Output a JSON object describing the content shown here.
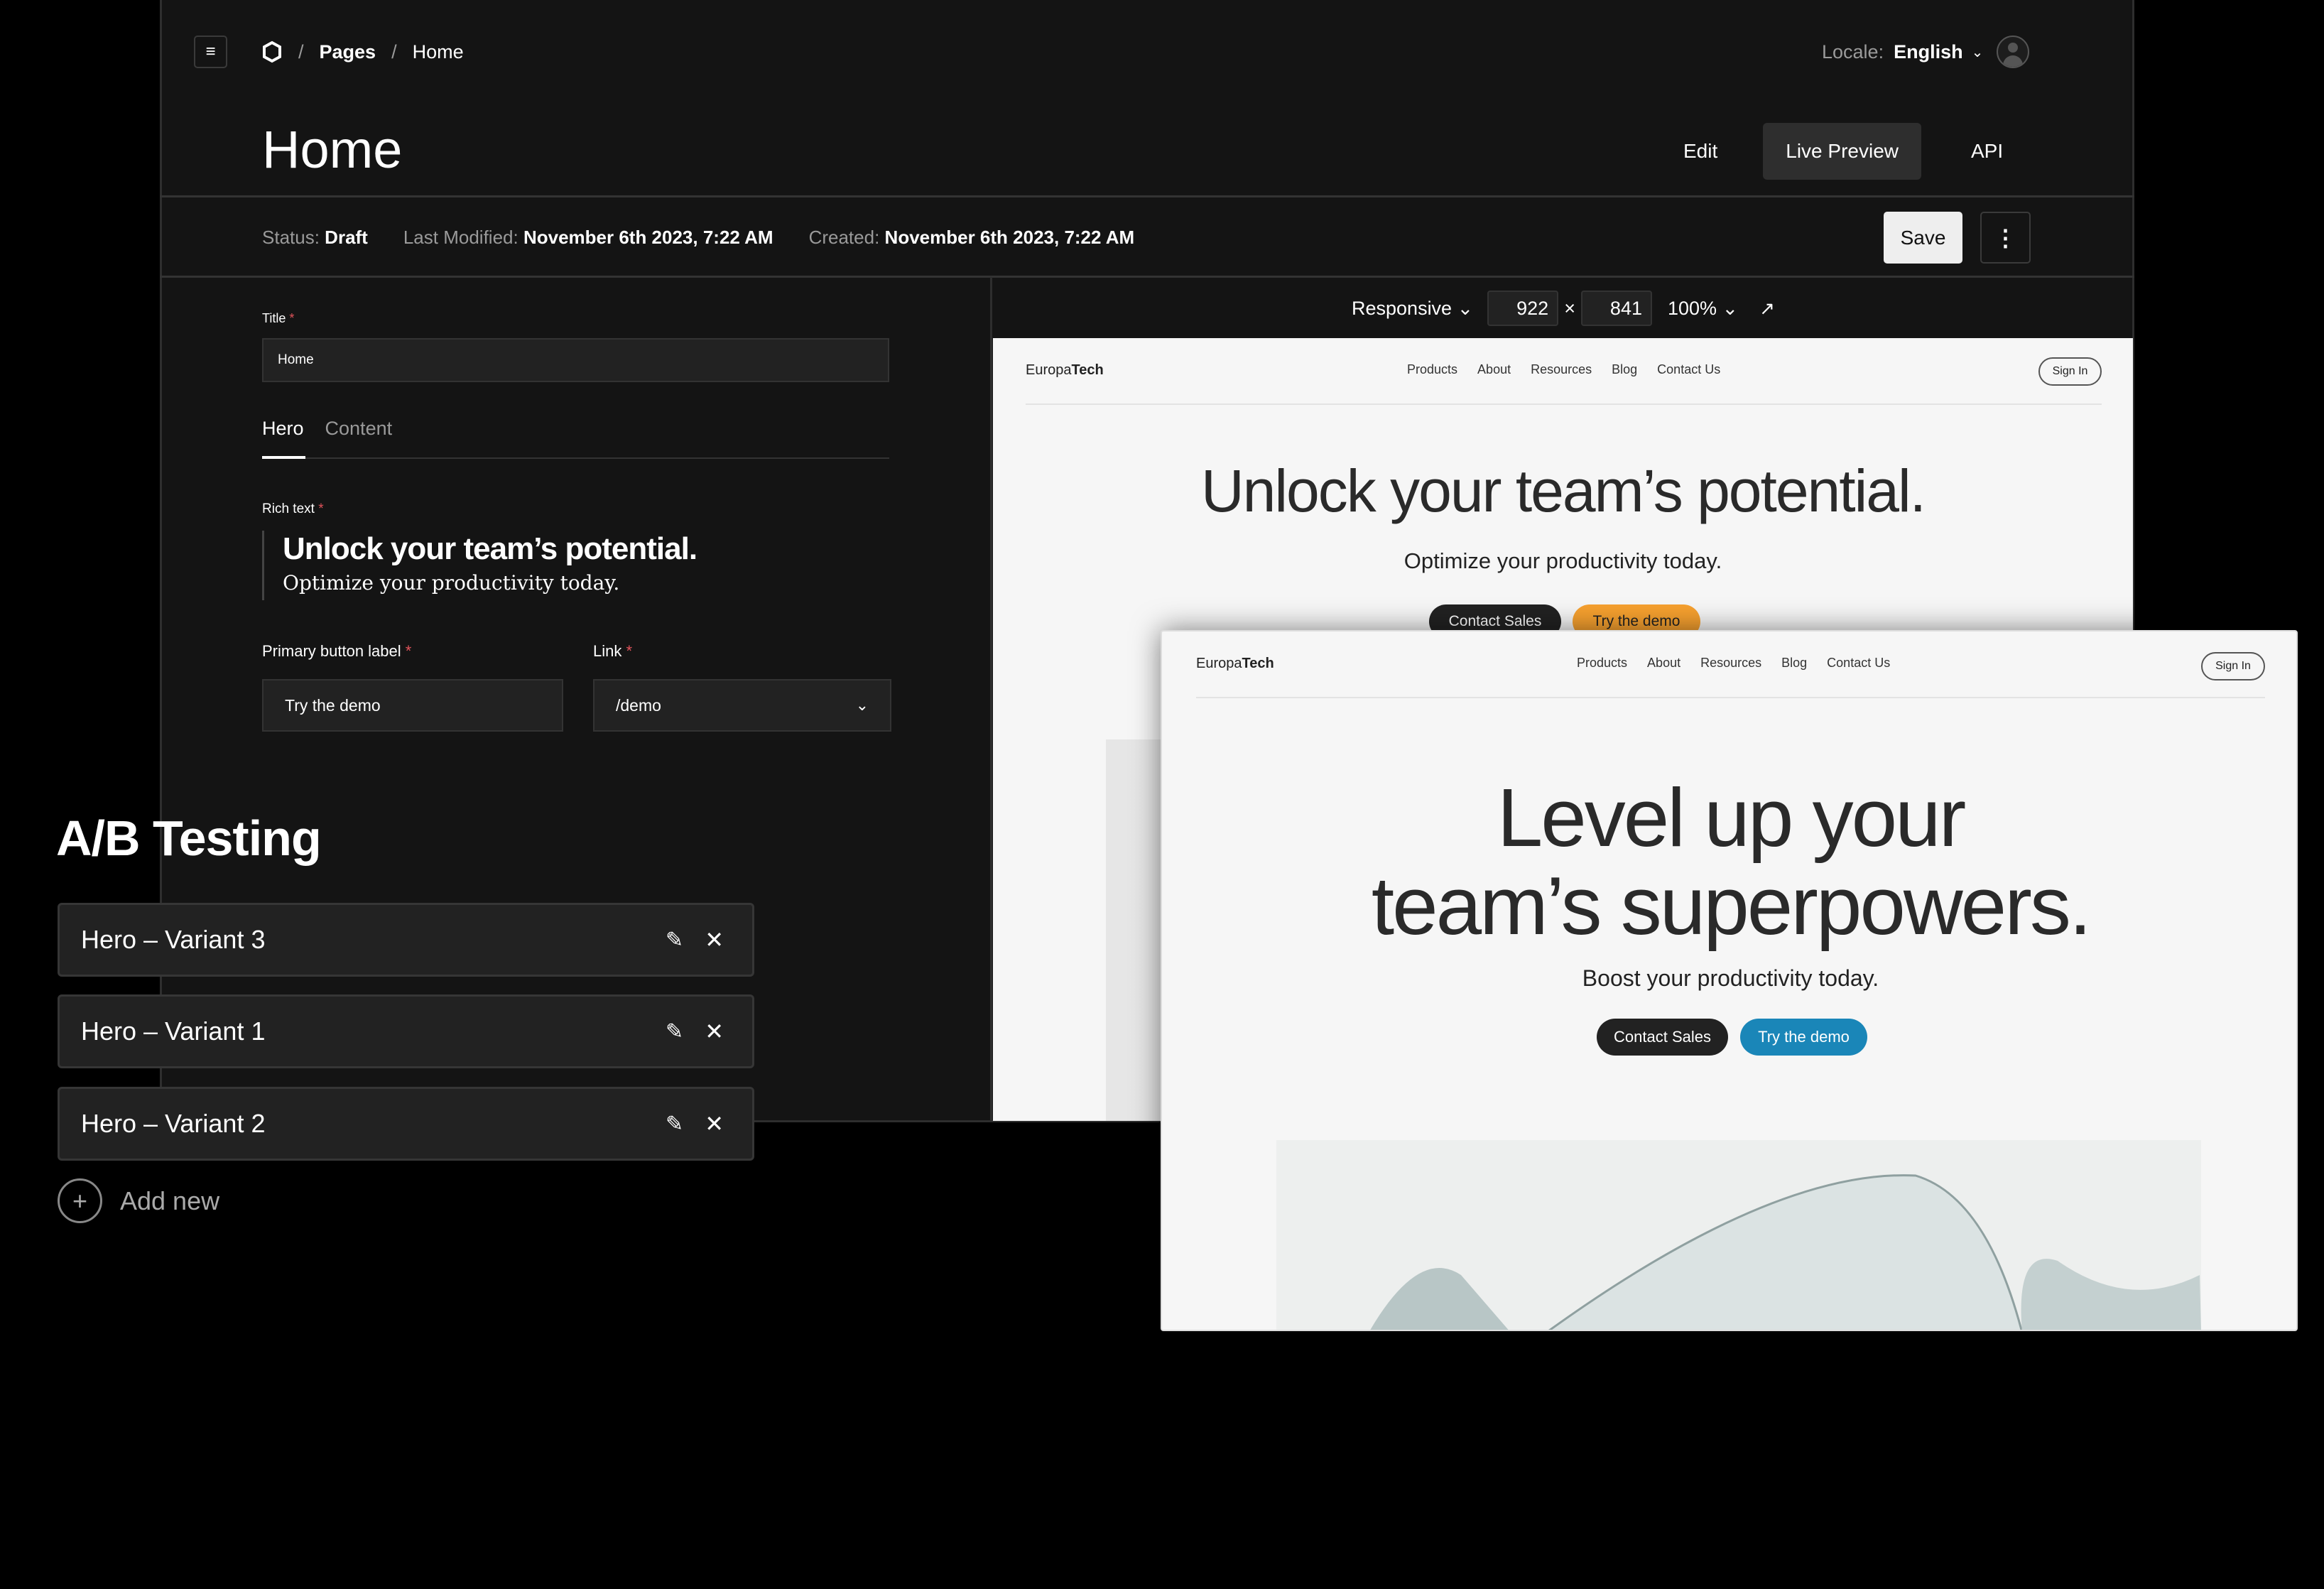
{
  "header": {
    "breadcrumb": [
      "Pages",
      "Home"
    ],
    "separator": "/",
    "locale_label": "Locale:",
    "locale_value": "English",
    "page_title": "Home",
    "tabs": [
      {
        "label": "Edit"
      },
      {
        "label": "Live Preview",
        "active": true
      },
      {
        "label": "API"
      }
    ]
  },
  "status_bar": {
    "status_label": "Status:",
    "status_value": "Draft",
    "modified_label": "Last Modified:",
    "modified_value": "November 6th 2023, 7:22 AM",
    "created_label": "Created:",
    "created_value": "November 6th 2023, 7:22 AM",
    "save_label": "Save"
  },
  "editor": {
    "title_label": "Title",
    "title_value": "Home",
    "tabs": [
      "Hero",
      "Content"
    ],
    "rich_text_label": "Rich text",
    "rich_heading": "Unlock your team’s potential.",
    "rich_sub": "Optimize your productivity today.",
    "button_label": "Primary button label",
    "button_value": "Try the demo",
    "link_label": "Link",
    "link_value": "/demo",
    "required_mark": "*"
  },
  "preview_toolbar": {
    "mode": "Responsive",
    "width": "922",
    "times": "×",
    "height": "841",
    "zoom": "100%"
  },
  "site": {
    "brand_a": "Europa",
    "brand_b": "Tech",
    "nav": [
      "Products",
      "About",
      "Resources",
      "Blog",
      "Contact Us"
    ],
    "sign_in": "Sign In"
  },
  "preview_a": {
    "headline": "Unlock your team’s potential.",
    "sub": "Optimize your productivity today.",
    "contact": "Contact Sales",
    "demo": "Try the demo",
    "demo_color": "#f7a12f"
  },
  "preview_b": {
    "headline_1": "Level up your",
    "headline_2": "team’s superpowers.",
    "sub": "Boost your productivity today.",
    "contact": "Contact Sales",
    "demo": "Try the demo",
    "demo_color": "#1a86b8"
  },
  "ab_testing": {
    "title": "A/B Testing",
    "variants": [
      "Hero – Variant 3",
      "Hero – Variant 1",
      "Hero – Variant 2"
    ],
    "add_new": "Add new"
  }
}
